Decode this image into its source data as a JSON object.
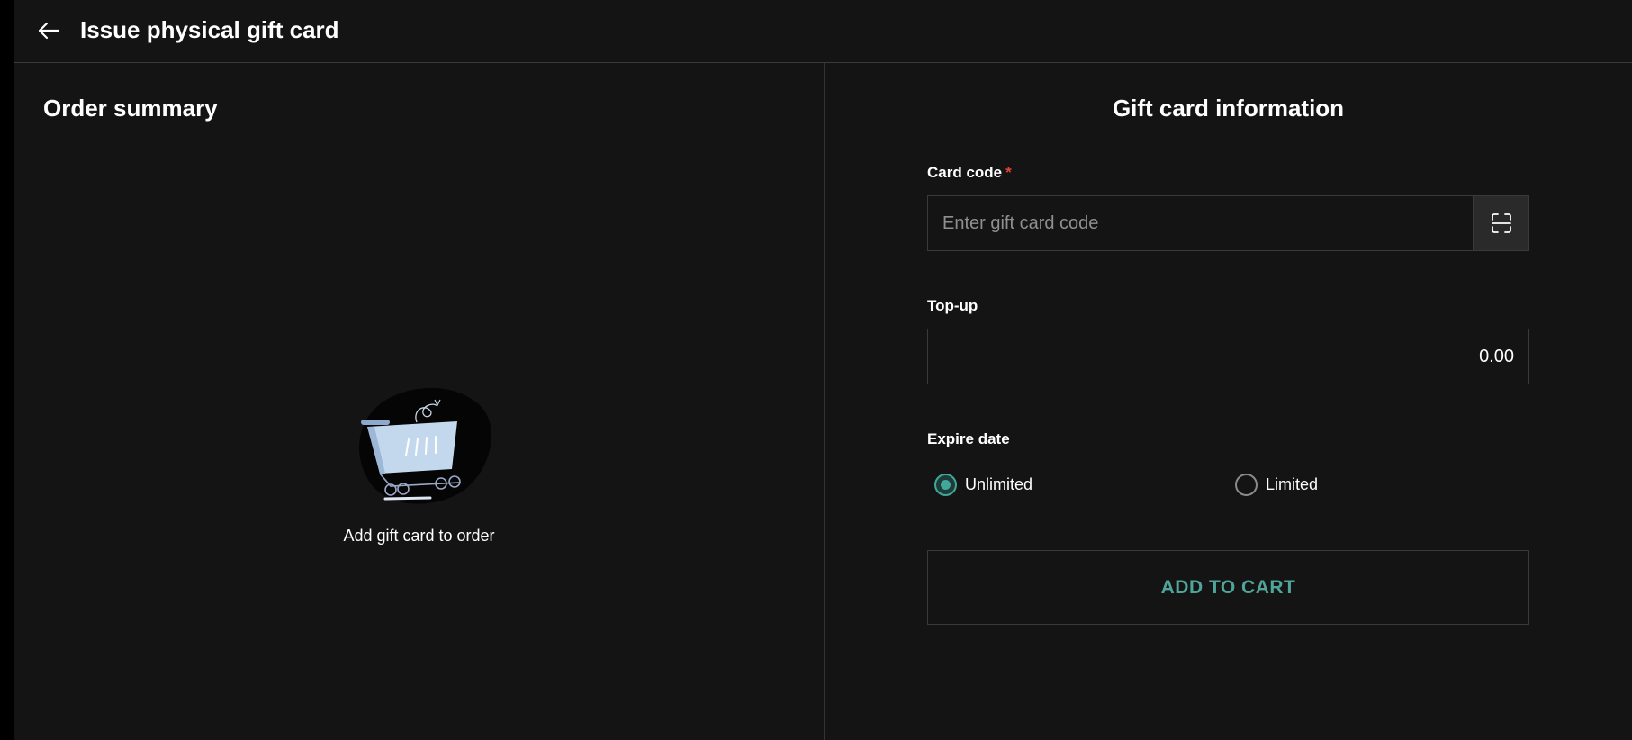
{
  "header": {
    "back_icon": "arrow-left-icon",
    "title": "Issue physical gift card"
  },
  "order_summary": {
    "title": "Order summary",
    "illustration": "empty-cart-illustration",
    "empty_text": "Add gift card to order"
  },
  "gift_card_info": {
    "title": "Gift card information",
    "card_code": {
      "label": "Card code",
      "required_mark": "*",
      "placeholder": "Enter gift card code",
      "value": "",
      "scan_icon": "barcode-scan-icon"
    },
    "top_up": {
      "label": "Top-up",
      "value": "0.00"
    },
    "expire_date": {
      "label": "Expire date",
      "options": [
        {
          "label": "Unlimited",
          "checked": true
        },
        {
          "label": "Limited",
          "checked": false
        }
      ]
    },
    "add_button": "ADD TO CART"
  },
  "colors": {
    "background": "#141414",
    "accent": "#4fa59a",
    "required": "#e0443c",
    "border": "#3a3a3a"
  }
}
